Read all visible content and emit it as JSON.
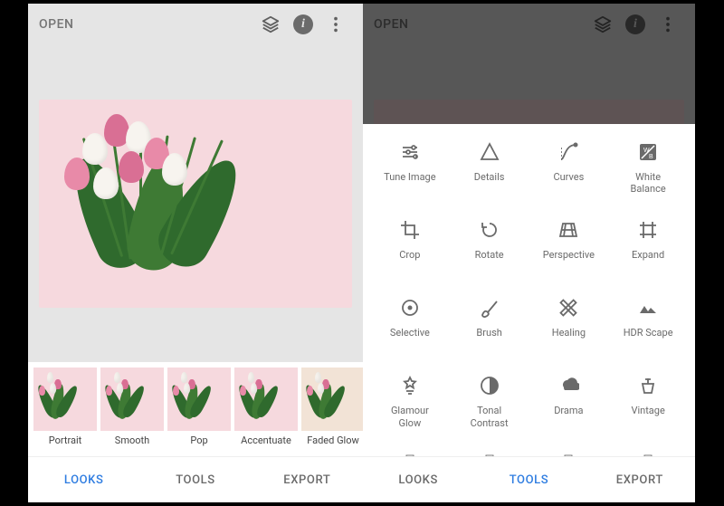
{
  "left": {
    "open_label": "OPEN",
    "nav": {
      "looks": "LOOKS",
      "tools": "TOOLS",
      "export": "EXPORT",
      "active": "looks"
    },
    "looks": [
      {
        "label": "Portrait"
      },
      {
        "label": "Smooth"
      },
      {
        "label": "Pop"
      },
      {
        "label": "Accentuate"
      },
      {
        "label": "Faded Glow"
      }
    ]
  },
  "right": {
    "open_label": "OPEN",
    "nav": {
      "looks": "LOOKS",
      "tools": "TOOLS",
      "export": "EXPORT",
      "active": "tools"
    },
    "tools": [
      {
        "icon": "tune",
        "label": "Tune Image"
      },
      {
        "icon": "details",
        "label": "Details"
      },
      {
        "icon": "curves",
        "label": "Curves"
      },
      {
        "icon": "wb",
        "label": "White\nBalance"
      },
      {
        "icon": "crop",
        "label": "Crop"
      },
      {
        "icon": "rotate",
        "label": "Rotate"
      },
      {
        "icon": "perspective",
        "label": "Perspective"
      },
      {
        "icon": "expand",
        "label": "Expand"
      },
      {
        "icon": "selective",
        "label": "Selective"
      },
      {
        "icon": "brush",
        "label": "Brush"
      },
      {
        "icon": "healing",
        "label": "Healing"
      },
      {
        "icon": "hdr",
        "label": "HDR Scape"
      },
      {
        "icon": "glamour",
        "label": "Glamour\nGlow"
      },
      {
        "icon": "tonal",
        "label": "Tonal\nContrast"
      },
      {
        "icon": "drama",
        "label": "Drama"
      },
      {
        "icon": "vintage",
        "label": "Vintage"
      }
    ]
  }
}
